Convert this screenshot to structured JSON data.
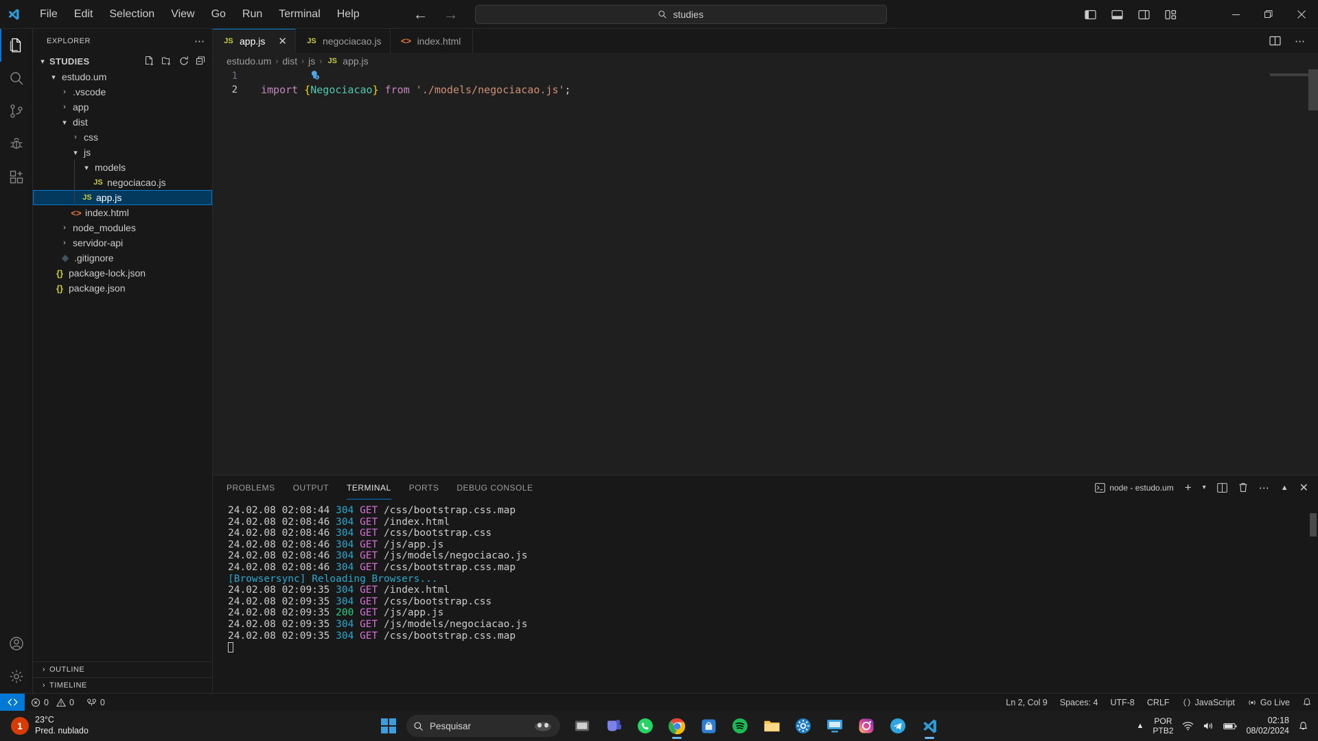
{
  "titlebar": {
    "logo_icon": "vscode-logo-icon",
    "menus": [
      "File",
      "Edit",
      "Selection",
      "View",
      "Go",
      "Run",
      "Terminal",
      "Help"
    ],
    "nav_back_icon": "arrow-left-icon",
    "nav_forward_icon": "arrow-right-icon",
    "command_center": {
      "search_icon": "search-icon",
      "text": "studies"
    },
    "layout_icons": [
      "toggle-primary-sidebar-icon",
      "toggle-panel-icon",
      "toggle-secondary-sidebar-icon",
      "customize-layout-icon"
    ],
    "window_controls": {
      "minimize": "minimize-icon",
      "restore": "restore-icon",
      "close": "close-icon"
    }
  },
  "activitybar": {
    "items": [
      {
        "name": "explorer",
        "icon": "files-icon",
        "active": true
      },
      {
        "name": "search",
        "icon": "search-icon",
        "active": false
      },
      {
        "name": "source-control",
        "icon": "source-control-icon",
        "active": false
      },
      {
        "name": "run-and-debug",
        "icon": "debug-icon",
        "active": false
      },
      {
        "name": "extensions",
        "icon": "extensions-icon",
        "active": false
      }
    ],
    "bottom": [
      {
        "name": "accounts",
        "icon": "account-icon"
      },
      {
        "name": "settings",
        "icon": "gear-icon"
      }
    ]
  },
  "sidebar": {
    "title": "EXPLORER",
    "more_actions_icon": "ellipsis-icon",
    "root": {
      "label": "STUDIES",
      "expanded": true,
      "actions": [
        "new-file-icon",
        "new-folder-icon",
        "refresh-icon",
        "collapse-all-icon"
      ]
    },
    "tree": [
      {
        "label": "estudo.um",
        "type": "folder",
        "expanded": true,
        "depth": 1,
        "icon": "chevron-down-icon"
      },
      {
        "label": ".vscode",
        "type": "folder",
        "expanded": false,
        "depth": 2,
        "icon": "chevron-right-icon"
      },
      {
        "label": "app",
        "type": "folder",
        "expanded": false,
        "depth": 2,
        "icon": "chevron-right-icon"
      },
      {
        "label": "dist",
        "type": "folder",
        "expanded": true,
        "depth": 2,
        "icon": "chevron-down-icon"
      },
      {
        "label": "css",
        "type": "folder",
        "expanded": false,
        "depth": 3,
        "icon": "chevron-right-icon"
      },
      {
        "label": "js",
        "type": "folder",
        "expanded": true,
        "depth": 3,
        "icon": "chevron-down-icon"
      },
      {
        "label": "models",
        "type": "folder",
        "expanded": true,
        "depth": 4,
        "icon": "chevron-down-icon"
      },
      {
        "label": "negociacao.js",
        "type": "file",
        "depth": 5,
        "icon": "js-file-icon",
        "badge": "JS"
      },
      {
        "label": "app.js",
        "type": "file",
        "depth": 4,
        "icon": "js-file-icon",
        "badge": "JS",
        "selected": true
      },
      {
        "label": "index.html",
        "type": "file",
        "depth": 3,
        "icon": "html-file-icon",
        "badge": "<>"
      },
      {
        "label": "node_modules",
        "type": "folder",
        "expanded": false,
        "depth": 2,
        "icon": "chevron-right-icon"
      },
      {
        "label": "servidor-api",
        "type": "folder",
        "expanded": false,
        "depth": 2,
        "icon": "chevron-right-icon"
      },
      {
        "label": ".gitignore",
        "type": "file",
        "depth": 2,
        "icon": "git-file-icon",
        "badge": "◆"
      },
      {
        "label": "package-lock.json",
        "type": "file",
        "depth": 2,
        "icon": "json-file-icon",
        "badge": "{}"
      },
      {
        "label": "package.json",
        "type": "file",
        "depth": 2,
        "icon": "json-file-icon",
        "badge": "{}"
      }
    ],
    "collapsed_panels": [
      {
        "label": "OUTLINE",
        "icon": "chevron-right-icon"
      },
      {
        "label": "TIMELINE",
        "icon": "chevron-right-icon"
      }
    ]
  },
  "editor": {
    "tabs": [
      {
        "label": "app.js",
        "badge": "JS",
        "active": true,
        "close_icon": "close-icon"
      },
      {
        "label": "negociacao.js",
        "badge": "JS",
        "active": false
      },
      {
        "label": "index.html",
        "badge": "<>",
        "active": false
      }
    ],
    "tab_actions": [
      "split-editor-icon",
      "more-actions-icon"
    ],
    "breadcrumb": [
      "estudo.um",
      "dist",
      "js",
      "app.js"
    ],
    "breadcrumb_file_badge": "JS",
    "breadcrumb_separator": "›",
    "lines": [
      {
        "number": "1",
        "codelens": true,
        "segments": []
      },
      {
        "number": "2",
        "codelens": false,
        "segments": [
          {
            "text": "import ",
            "cls": "tok-kw"
          },
          {
            "text": "{",
            "cls": "tok-brace"
          },
          {
            "text": "Negociacao",
            "cls": "tok-cls"
          },
          {
            "text": "}",
            "cls": "tok-brace"
          },
          {
            "text": " from ",
            "cls": "tok-kw"
          },
          {
            "text": "'./models/negociacao.js'",
            "cls": "tok-str"
          },
          {
            "text": ";",
            "cls": "tok-punct"
          }
        ]
      }
    ]
  },
  "panel": {
    "tabs": [
      "PROBLEMS",
      "OUTPUT",
      "TERMINAL",
      "PORTS",
      "DEBUG CONSOLE"
    ],
    "active_tab": "TERMINAL",
    "terminal_selector": {
      "icon": "terminal-icon",
      "label": "node - estudo.um"
    },
    "actions": [
      "new-terminal-icon",
      "chevron-down-icon",
      "split-terminal-icon",
      "kill-terminal-icon",
      "more-actions-icon",
      "maximize-panel-icon",
      "close-panel-icon"
    ],
    "terminal_lines": [
      {
        "ts": "24.02.08 02:08:44",
        "status": "304",
        "method": "GET",
        "path": "/css/bootstrap.css.map"
      },
      {
        "ts": "24.02.08 02:08:46",
        "status": "304",
        "method": "GET",
        "path": "/index.html"
      },
      {
        "ts": "24.02.08 02:08:46",
        "status": "304",
        "method": "GET",
        "path": "/css/bootstrap.css"
      },
      {
        "ts": "24.02.08 02:08:46",
        "status": "304",
        "method": "GET",
        "path": "/js/app.js"
      },
      {
        "ts": "24.02.08 02:08:46",
        "status": "304",
        "method": "GET",
        "path": "/js/models/negociacao.js"
      },
      {
        "ts": "24.02.08 02:08:46",
        "status": "304",
        "method": "GET",
        "path": "/css/bootstrap.css.map"
      },
      {
        "browsersync": "[Browsersync]",
        "message": " Reloading Browsers..."
      },
      {
        "ts": "24.02.08 02:09:35",
        "status": "304",
        "method": "GET",
        "path": "/index.html"
      },
      {
        "ts": "24.02.08 02:09:35",
        "status": "304",
        "method": "GET",
        "path": "/css/bootstrap.css"
      },
      {
        "ts": "24.02.08 02:09:35",
        "status": "200",
        "method": "GET",
        "path": "/js/app.js"
      },
      {
        "ts": "24.02.08 02:09:35",
        "status": "304",
        "method": "GET",
        "path": "/js/models/negociacao.js"
      },
      {
        "ts": "24.02.08 02:09:35",
        "status": "304",
        "method": "GET",
        "path": "/css/bootstrap.css.map"
      }
    ]
  },
  "statusbar": {
    "remote_icon": "remote-window-icon",
    "problems": {
      "errors_icon": "error-icon",
      "errors": "0",
      "warnings_icon": "warning-icon",
      "warnings": "0"
    },
    "ports": {
      "icon": "ports-icon",
      "count": "0"
    },
    "cursor_position": "Ln 2, Col 9",
    "indentation": "Spaces: 4",
    "encoding": "UTF-8",
    "eol": "CRLF",
    "language": "JavaScript",
    "language_icon": "braces-icon",
    "golive": {
      "icon": "broadcast-icon",
      "label": "Go Live"
    },
    "notifications_icon": "bell-icon"
  },
  "taskbar": {
    "weather": {
      "temperature": "23°C",
      "condition": "Pred. nublado",
      "badge": "1"
    },
    "start_icon": "windows-start-icon",
    "search": {
      "icon": "search-icon",
      "placeholder": "Pesquisar",
      "widget_icon": "copilot-icon"
    },
    "apps": [
      {
        "name": "task-view",
        "icon": "task-view-icon"
      },
      {
        "name": "microsoft-teams",
        "icon": "teams-icon"
      },
      {
        "name": "whatsapp",
        "icon": "whatsapp-icon"
      },
      {
        "name": "google-chrome",
        "icon": "chrome-icon",
        "active": true
      },
      {
        "name": "app-store",
        "icon": "store-icon"
      },
      {
        "name": "spotify",
        "icon": "spotify-icon"
      },
      {
        "name": "file-explorer",
        "icon": "file-explorer-icon"
      },
      {
        "name": "settings",
        "icon": "settings-gear-icon"
      },
      {
        "name": "remote-desktop",
        "icon": "remote-desktop-icon"
      },
      {
        "name": "instagram",
        "icon": "instagram-icon"
      },
      {
        "name": "telegram",
        "icon": "telegram-icon"
      },
      {
        "name": "visual-studio-code",
        "icon": "vscode-icon",
        "active": true
      }
    ],
    "tray": {
      "overflow_icon": "chevron-up-icon",
      "language": {
        "line1": "POR",
        "line2": "PTB2"
      },
      "network_icon": "wifi-icon",
      "volume_icon": "speaker-icon",
      "battery_icon": "battery-icon",
      "clock": {
        "time": "02:18",
        "date": "08/02/2024"
      },
      "notification_icon": "notification-bell-icon"
    }
  }
}
